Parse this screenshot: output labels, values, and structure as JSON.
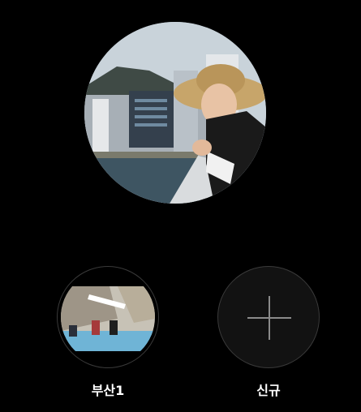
{
  "highlights": [
    {
      "label": "부산1"
    },
    {
      "label": "신규"
    }
  ],
  "colors": {
    "background": "#000000",
    "text": "#ffffff",
    "ring": "#3a3a3a",
    "plus": "#8a8a8a"
  },
  "icons": {
    "new_highlight": "plus-icon"
  }
}
